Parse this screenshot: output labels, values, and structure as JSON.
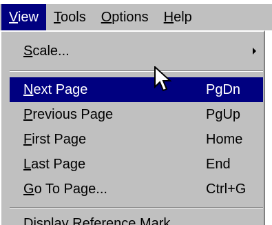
{
  "menubar": {
    "items": [
      {
        "mnemonic": "V",
        "rest": "iew"
      },
      {
        "mnemonic": "T",
        "rest": "ools"
      },
      {
        "mnemonic": "O",
        "rest": "ptions"
      },
      {
        "mnemonic": "H",
        "rest": "elp"
      }
    ]
  },
  "view_menu": {
    "scale": {
      "mnemonic": "S",
      "rest": "cale..."
    },
    "items": [
      {
        "mnemonic": "N",
        "rest": "ext Page",
        "shortcut": "PgDn"
      },
      {
        "mnemonic": "P",
        "rest": "revious Page",
        "shortcut": "PgUp"
      },
      {
        "mnemonic": "F",
        "rest": "irst Page",
        "shortcut": "Home"
      },
      {
        "mnemonic": "L",
        "rest": "ast Page",
        "shortcut": "End"
      },
      {
        "mnemonic": "G",
        "rest": "o To Page...",
        "shortcut": "Ctrl+G"
      }
    ],
    "display_ref": {
      "mnemonic": "D",
      "rest": "isplay Reference Mark"
    }
  },
  "highlighted_index": 0,
  "colors": {
    "menu_bg": "#c0c0c0",
    "highlight_bg": "#000080",
    "highlight_text": "#ffffff"
  },
  "icons": {
    "cursor": "mouse-pointer-icon",
    "submenu": "submenu-arrow-icon"
  }
}
